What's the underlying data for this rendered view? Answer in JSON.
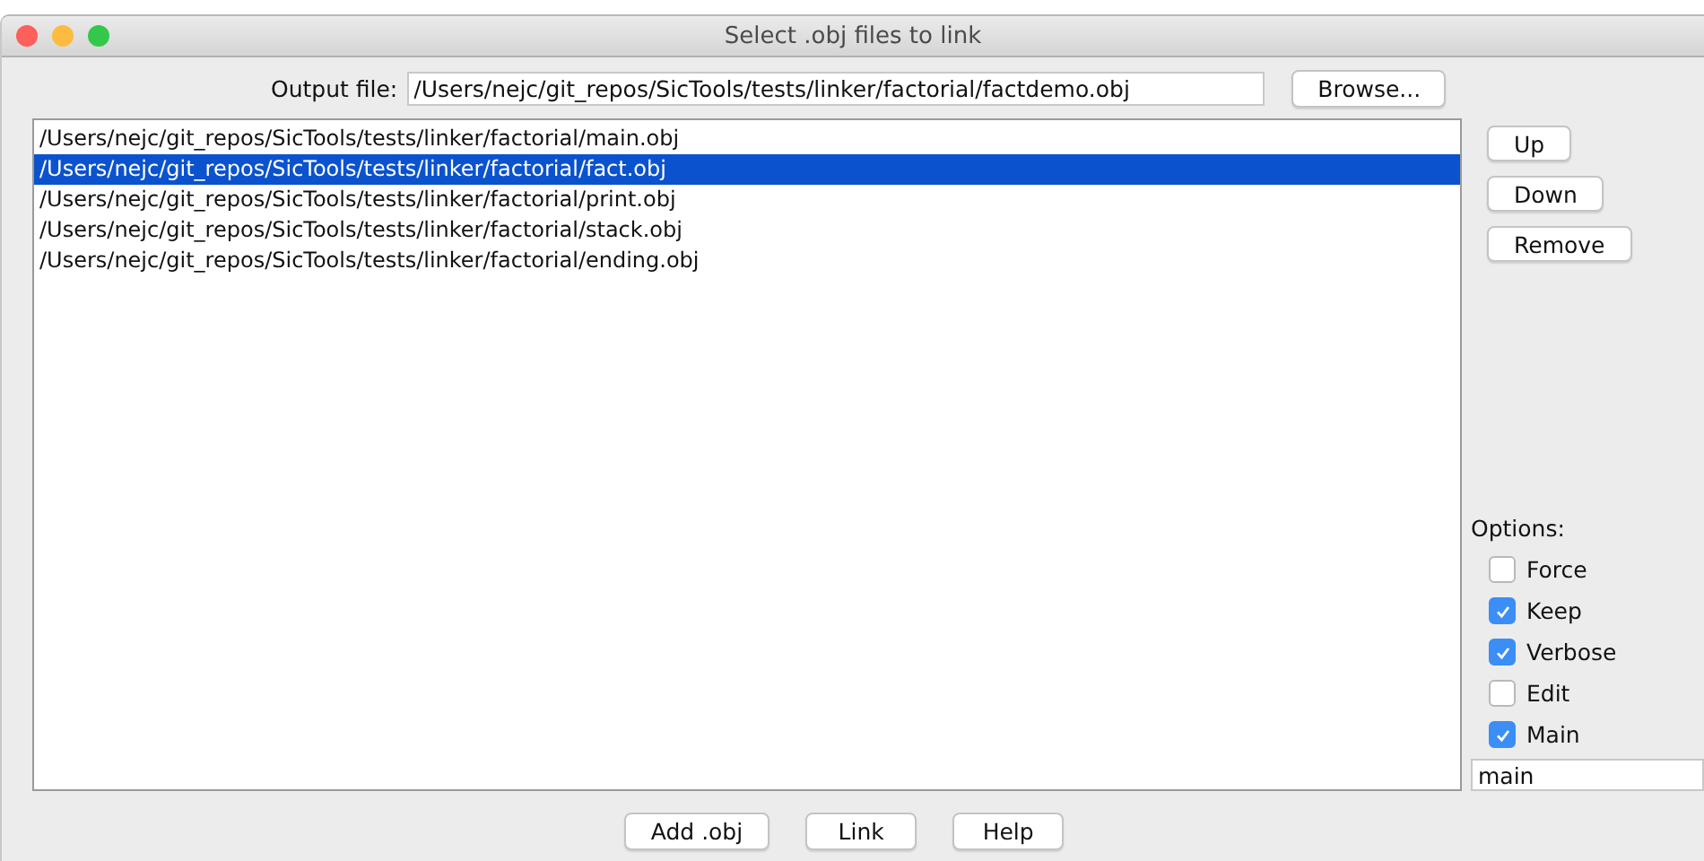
{
  "window": {
    "title": "Select .obj files to link"
  },
  "output_file": {
    "label": "Output file:",
    "value": "/Users/nejc/git_repos/SicTools/tests/linker/factorial/factdemo.obj",
    "browse_button": "Browse..."
  },
  "files": [
    {
      "path": "/Users/nejc/git_repos/SicTools/tests/linker/factorial/main.obj",
      "selected": false
    },
    {
      "path": "/Users/nejc/git_repos/SicTools/tests/linker/factorial/fact.obj",
      "selected": true
    },
    {
      "path": "/Users/nejc/git_repos/SicTools/tests/linker/factorial/print.obj",
      "selected": false
    },
    {
      "path": "/Users/nejc/git_repos/SicTools/tests/linker/factorial/stack.obj",
      "selected": false
    },
    {
      "path": "/Users/nejc/git_repos/SicTools/tests/linker/factorial/ending.obj",
      "selected": false
    }
  ],
  "side_buttons": [
    "Up",
    "Down",
    "Remove"
  ],
  "options": {
    "label": "Options:",
    "items": [
      {
        "label": "Force",
        "checked": false
      },
      {
        "label": "Keep",
        "checked": true
      },
      {
        "label": "Verbose",
        "checked": true
      },
      {
        "label": "Edit",
        "checked": false
      },
      {
        "label": "Main",
        "checked": true
      }
    ],
    "main_value": "main"
  },
  "bottom_buttons": [
    "Add .obj",
    "Link",
    "Help"
  ]
}
